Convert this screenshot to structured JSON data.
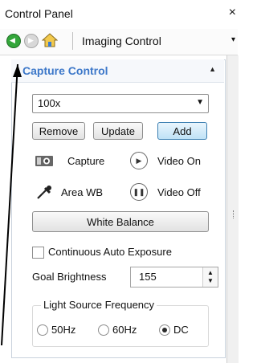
{
  "window": {
    "title": "Control Panel",
    "close": "×"
  },
  "toolbar": {
    "title": "Imaging Control",
    "dropdown_arrow": "▾"
  },
  "section": {
    "title": "Capture Control",
    "collapse": "▲"
  },
  "preset": {
    "value": "100x",
    "arrow": "▼"
  },
  "buttons": {
    "remove": "Remove",
    "update": "Update",
    "add": "Add",
    "white_balance": "White Balance"
  },
  "actions": {
    "capture": "Capture",
    "video_on": "Video On",
    "area_wb": "Area WB",
    "video_off": "Video Off"
  },
  "auto_exposure": {
    "label": "Continuous Auto Exposure",
    "checked": false
  },
  "goal_brightness": {
    "label": "Goal Brightness",
    "value": "155"
  },
  "light_source": {
    "label": "Light Source Frequency",
    "options": [
      "50Hz",
      "60Hz",
      "DC"
    ],
    "selected": "DC"
  },
  "colors": {
    "accent": "#3d78c9",
    "primary_button": "#bfe2f6"
  }
}
